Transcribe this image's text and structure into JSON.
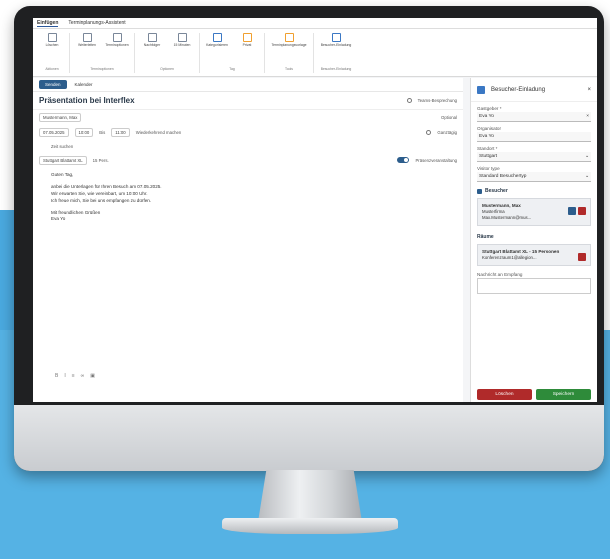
{
  "ribbon": {
    "tabs": [
      "Einfügen",
      "Terminplanungs-Assistent"
    ],
    "groups": [
      {
        "label": "Aktionen",
        "buttons": [
          "Löschen"
        ]
      },
      {
        "label": "Terminoptionen",
        "buttons": [
          "Weiterleiten",
          "Terminoptionen"
        ]
      },
      {
        "label": "Optionen",
        "buttons": [
          "Nachfolger",
          "15 Minuten",
          "Optionen"
        ]
      },
      {
        "label": "Tag",
        "buttons": [
          "Kategorisieren",
          "Privat"
        ]
      },
      {
        "label": "Tools",
        "buttons": [
          "Terminplanungsvorlage"
        ]
      },
      {
        "label": "Besucher-Einladung",
        "buttons": [
          "Besucher-Einladung"
        ]
      }
    ]
  },
  "toolbar": {
    "send_label": "Senden",
    "calendar_label": "Kalender"
  },
  "form": {
    "subject": "Präsentation bei Interflex",
    "teams_label": "Teams-Besprechung",
    "attendee": "Mustermann, Max",
    "optional_label": "Optional",
    "start_date": "07.05.2025",
    "start_time": "10:00",
    "end_label": "Bis",
    "end_time": "11:00",
    "recurring_label": "Wiederkehrend machen",
    "all_day_label": "Ganztägig",
    "suggest_label": "Zeit suchen",
    "room_chip": "Stuttgart Blattamt XL",
    "room_extra": "15 Pers.",
    "online_label": "Präsenzveranstaltung"
  },
  "body": {
    "lines": [
      "Guten Tag,",
      "",
      "anbei die Unterlagen für Ihren Besuch am 07.05.2025.",
      "Wir erwarten Sie, wie vereinbart, um 10:00 Uhr.",
      "Ich freue mich, Sie bei uns empfangen zu dürfen.",
      "",
      "Mit freundlichen Grüßen",
      "Eva Yo"
    ]
  },
  "panel": {
    "title": "Besucher-Einladung",
    "host_label": "Gastgeber *",
    "host_value": "Eva Yo",
    "organizer_label": "Organisator",
    "organizer_value": "Eva Yo",
    "site_label": "Standort *",
    "site_value": "Stuttgart",
    "visitor_type_label": "Visitor type",
    "visitor_type_value": "Standard Besuchertyp",
    "visitors_section": "Besucher",
    "visitor_name": "Mustermann, Max",
    "visitor_company": "Musterfirma",
    "visitor_email": "Max.Mustermann@mus...",
    "rooms_section": "Räume",
    "room_name": "Stuttgart Blattamt XL - 15 Personen",
    "room_email": "Konferenzraum1@allegion...",
    "message_label": "Nachricht an Empfang",
    "delete_label": "Löschen",
    "save_label": "Speichern"
  },
  "colors": {
    "accent": "#2c5d8c",
    "delete": "#b02a2a",
    "save": "#2e8b3a",
    "background": "#55b2e4"
  }
}
